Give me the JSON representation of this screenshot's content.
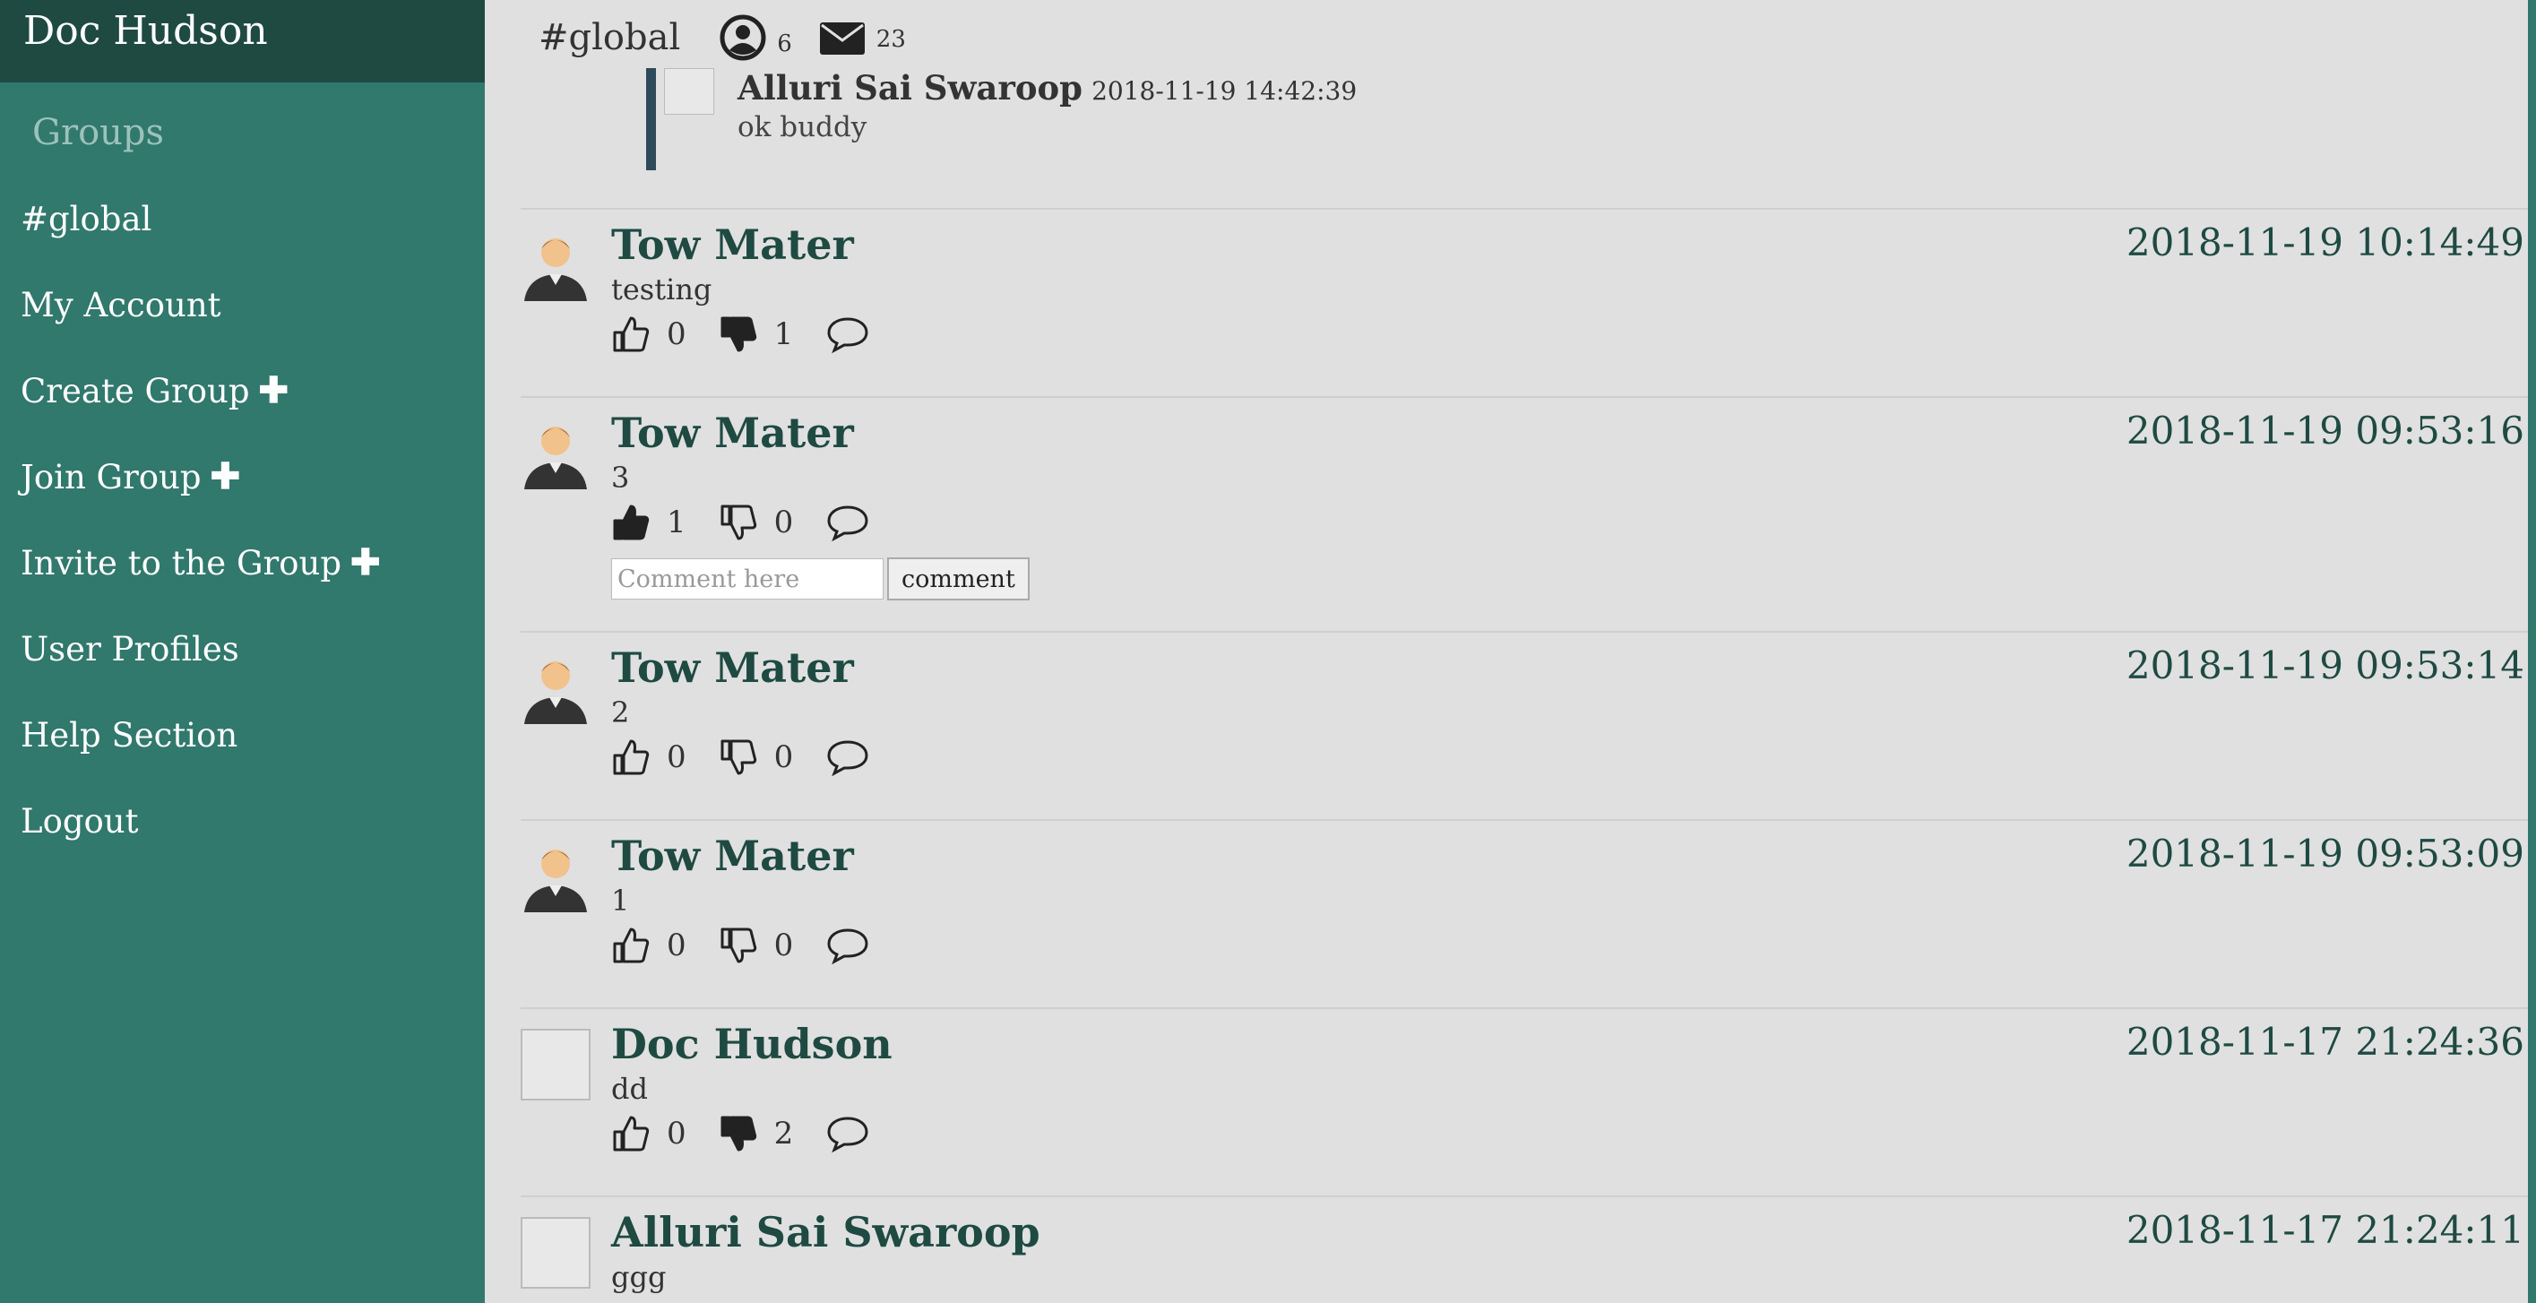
{
  "sidebar": {
    "user_name": "Doc Hudson",
    "groups_label": "Groups",
    "items": [
      {
        "label": "#global",
        "plus": false
      },
      {
        "label": "My Account",
        "plus": false
      },
      {
        "label": "Create Group",
        "plus": true
      },
      {
        "label": "Join Group",
        "plus": true
      },
      {
        "label": "Invite to the Group",
        "plus": true
      },
      {
        "label": "User Profiles",
        "plus": false
      },
      {
        "label": "Help Section",
        "plus": false
      },
      {
        "label": "Logout",
        "plus": false
      }
    ]
  },
  "header": {
    "group_name": "#global",
    "members_count": "6",
    "messages_count": "23"
  },
  "quoted_reply": {
    "author": "Alluri Sai Swaroop",
    "time": "2018-11-19 14:42:39",
    "text": "ok buddy"
  },
  "posts": [
    {
      "author": "Tow Mater",
      "time": "2018-11-19 10:14:49",
      "text": "testing",
      "likes": "0",
      "dislikes": "1",
      "liked": false,
      "disliked": true
    },
    {
      "author": "Tow Mater",
      "time": "2018-11-19 09:53:16",
      "text": "3",
      "likes": "1",
      "dislikes": "0",
      "liked": true,
      "disliked": false
    },
    {
      "author": "Tow Mater",
      "time": "2018-11-19 09:53:14",
      "text": "2",
      "likes": "0",
      "dislikes": "0",
      "liked": false,
      "disliked": false
    },
    {
      "author": "Tow Mater",
      "time": "2018-11-19 09:53:09",
      "text": "1",
      "likes": "0",
      "dislikes": "0",
      "liked": false,
      "disliked": false
    },
    {
      "author": "Doc Hudson",
      "time": "2018-11-17 21:24:36",
      "text": "dd",
      "likes": "0",
      "dislikes": "2",
      "liked": false,
      "disliked": true
    },
    {
      "author": "Alluri Sai Swaroop",
      "time": "2018-11-17 21:24:11",
      "text": "ggg"
    }
  ],
  "comment_box": {
    "placeholder": "Comment here",
    "button_label": "comment"
  },
  "colors": {
    "sidebar": "#31786d",
    "sidebar_header": "#1e4a42",
    "accent_text": "#1e4a42",
    "background": "#e0e0e0"
  }
}
